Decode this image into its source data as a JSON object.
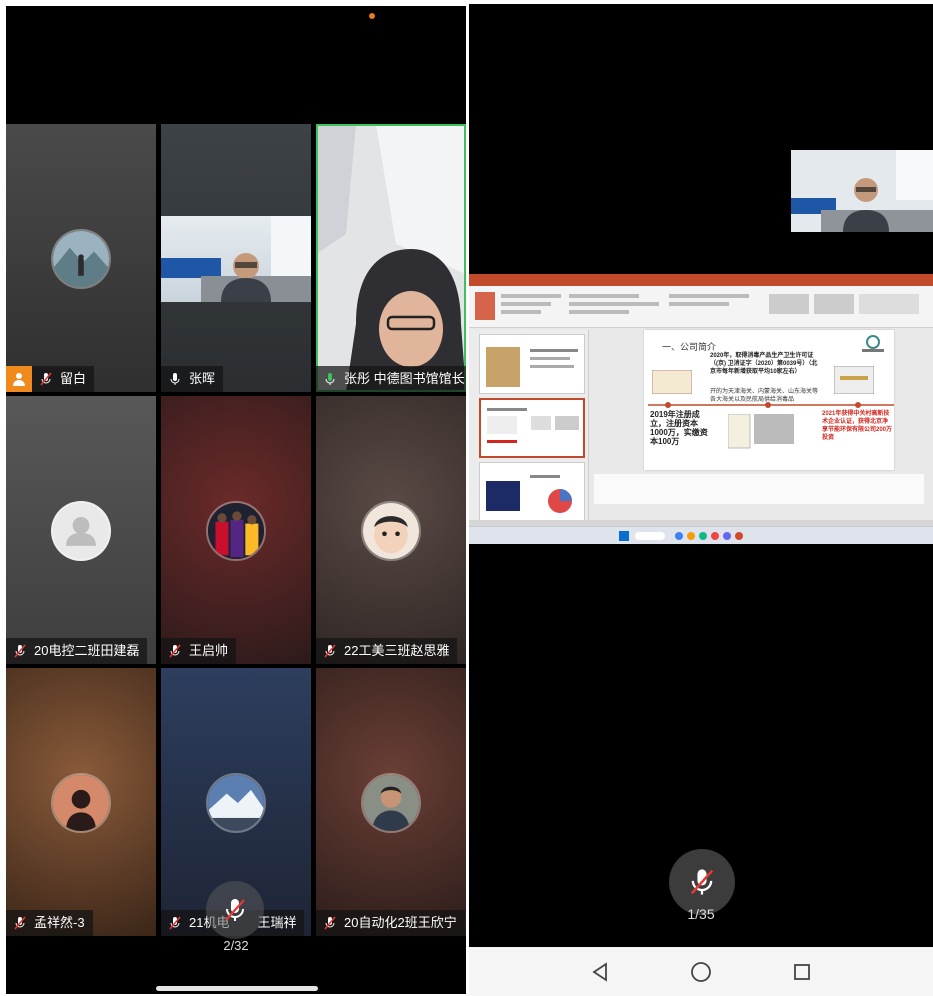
{
  "left_screen": {
    "participants": [
      {
        "name": "留白",
        "mic": "muted",
        "has_orange_badge": true
      },
      {
        "name": "张晖",
        "mic": "on"
      },
      {
        "name": "张彤 中德图书馆馆长",
        "mic": "speaking",
        "active": true
      },
      {
        "name": "20电控二班田建磊",
        "mic": "muted"
      },
      {
        "name": "王启帅",
        "mic": "muted"
      },
      {
        "name": "22工美三班赵思雅",
        "mic": "muted"
      },
      {
        "name": "孟祥然-3",
        "mic": "muted"
      },
      {
        "name": "21机电",
        "name_suffix": "王瑞祥",
        "mic": "muted"
      },
      {
        "name": "20自动化2班王欣宁",
        "mic": "muted"
      }
    ],
    "page_indicator": "2/32"
  },
  "right_screen": {
    "speaker_name": "张晖",
    "shared_slide": {
      "title": "一、公司简介",
      "text_2020": "2020年，取得消毒产品生产卫生许可证（(京) 卫消证字（2020）第0039号）（北京市每年新增获取平均10家左右）",
      "text_2020_b": "开的为天津海关、内蒙海关、山东海关等各大海关以及民航局供给消毒品",
      "text_2019": "2019年注册成立，注册资本1000万，实缴资本100万",
      "text_2021": "2021年获得中关村高新技术企业认证，获得北京净享节能环保有限公司200万投资"
    },
    "page_indicator": "1/35"
  },
  "colors": {
    "active_border": "#3ec15a",
    "orange_badge": "#f08a1c",
    "ppt_red": "#c14a2b"
  }
}
